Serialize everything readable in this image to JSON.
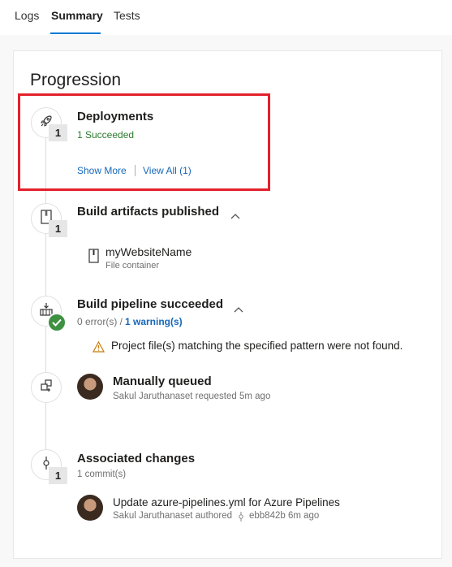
{
  "tabs": [
    {
      "label": "Logs"
    },
    {
      "label": "Summary"
    },
    {
      "label": "Tests"
    }
  ],
  "page_title": "Progression",
  "deployments": {
    "title": "Deployments",
    "count": "1",
    "status": "1 Succeeded",
    "show_more": "Show More",
    "view_all": "View All (1)"
  },
  "artifacts": {
    "title": "Build artifacts published",
    "count": "1",
    "item_name": "myWebsiteName",
    "item_type": "File container"
  },
  "pipeline": {
    "title": "Build pipeline succeeded",
    "errors": "0 error(s) /",
    "warnings": "1 warning(s)",
    "warning_message": "Project file(s) matching the specified pattern were not found."
  },
  "queued": {
    "title": "Manually queued",
    "detail": "Sakul Jaruthanaset requested 5m ago"
  },
  "changes": {
    "title": "Associated changes",
    "count": "1",
    "commits": "1 commit(s)",
    "commit_message": "Update azure-pipelines.yml for Azure Pipelines",
    "commit_author": "Sakul Jaruthanaset authored",
    "commit_hash_time": "ebb842b 6m ago"
  },
  "colors": {
    "accent": "#0078d4",
    "success": "#3f9142",
    "warning": "#c87d0a",
    "highlight": "#e3202b"
  }
}
